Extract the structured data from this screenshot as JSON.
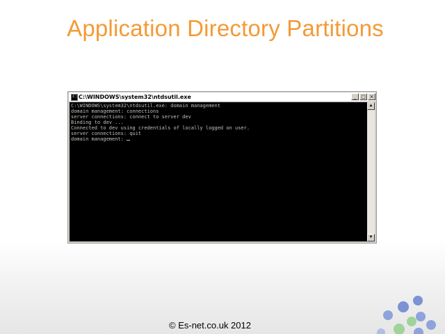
{
  "slide": {
    "title": "Application Directory Partitions",
    "footer": "© Es-net.co.uk 2012"
  },
  "window": {
    "title": "C:\\WINDOWS\\system32\\ntdsutil.exe",
    "minimize": "_",
    "maximize": "□",
    "close": "×"
  },
  "console": {
    "lines": [
      "C:\\WINDOWS\\system32\\ntdsutil.exe: domain management",
      "domain management: connections",
      "server connections: connect to server dev",
      "Binding to dev ...",
      "Connected to dev using credentials of locally logged on user.",
      "server connections: quit",
      "domain management: "
    ]
  },
  "scrollbar": {
    "up": "▲",
    "down": "▼"
  },
  "colors": {
    "title": "#f39a37",
    "console_bg": "#000000",
    "console_fg": "#c0c0c0",
    "bubble_blue": "#7b93d4",
    "bubble_green": "#9fd39a"
  }
}
